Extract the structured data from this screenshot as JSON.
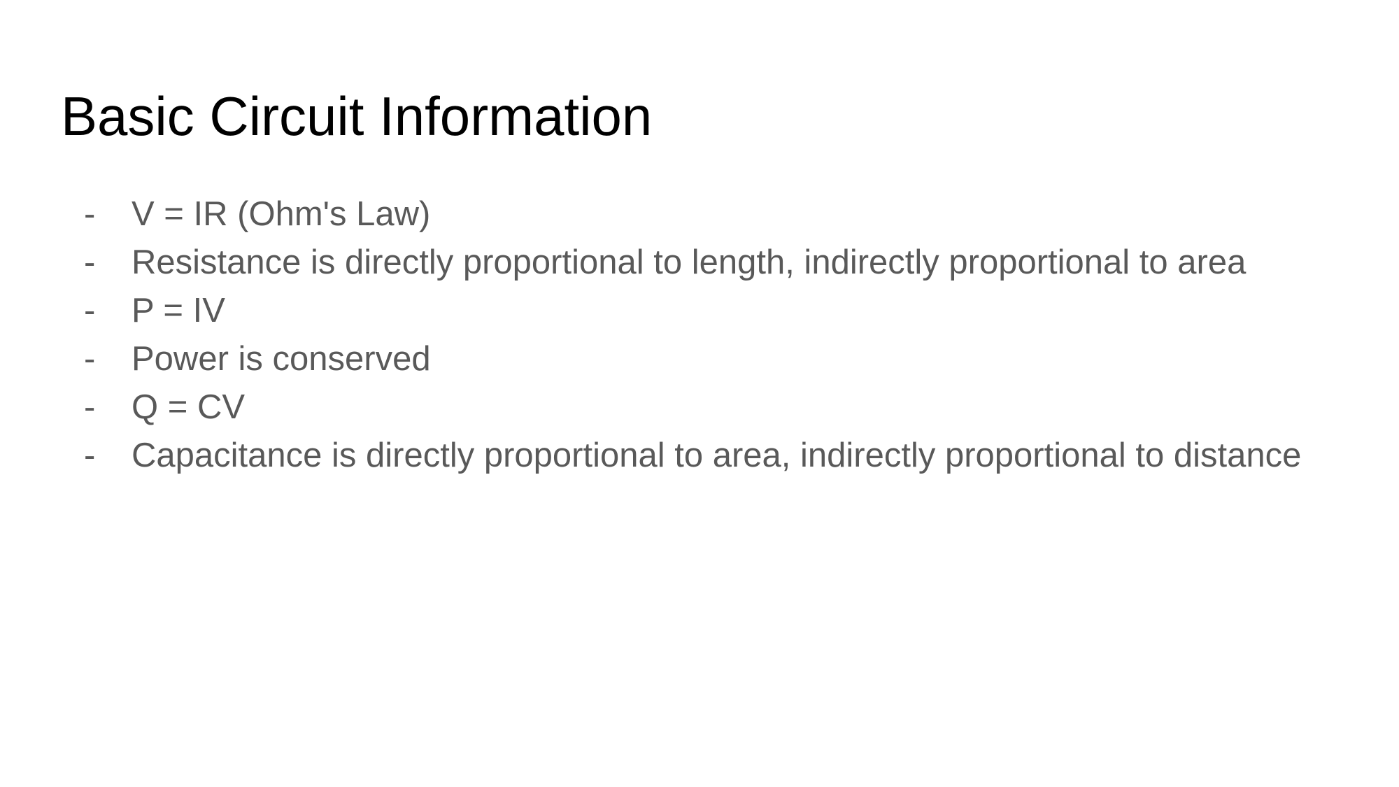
{
  "slide": {
    "title": "Basic Circuit Information",
    "bullet_marker": "-",
    "bullets": [
      "V = IR (Ohm's Law)",
      "Resistance is directly proportional to length, indirectly proportional to area",
      "P = IV",
      "Power is conserved",
      "Q = CV",
      "Capacitance is directly proportional to area, indirectly proportional to distance"
    ]
  },
  "colors": {
    "background": "#ffffff",
    "title": "#000000",
    "body_text": "#595959"
  }
}
